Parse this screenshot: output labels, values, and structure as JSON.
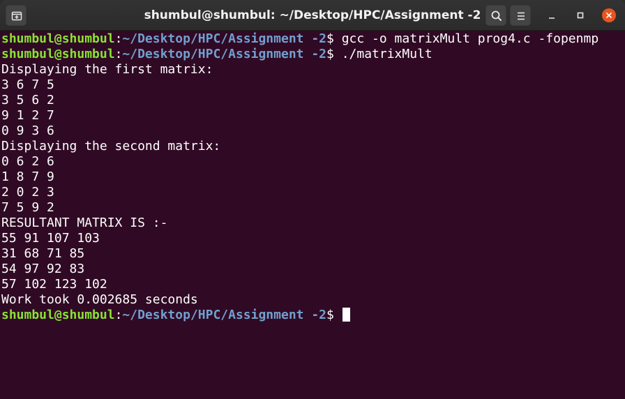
{
  "window": {
    "title": "shumbul@shumbul: ~/Desktop/HPC/Assignment -2",
    "icons": {
      "new_tab": "new-tab-icon",
      "search": "search-icon",
      "menu": "hamburger-menu-icon",
      "minimize": "minimize-icon",
      "maximize": "maximize-icon",
      "close": "close-icon"
    },
    "colors": {
      "terminal_bg": "#300a24",
      "prompt_user": "#8ae234",
      "prompt_path": "#729fcf",
      "text": "#ffffff",
      "close_button": "#e95420"
    }
  },
  "terminal": {
    "lines": [
      {
        "type": "prompt",
        "user": "shumbul@shumbul",
        "sep": ":",
        "path": "~/Desktop/HPC/Assignment -2",
        "sign": "$",
        "cmd": " gcc -o matrixMult prog4.c -fopenmp"
      },
      {
        "type": "prompt",
        "user": "shumbul@shumbul",
        "sep": ":",
        "path": "~/Desktop/HPC/Assignment -2",
        "sign": "$",
        "cmd": " ./matrixMult"
      },
      {
        "type": "output",
        "text": "Displaying the first matrix:"
      },
      {
        "type": "output",
        "text": "3 6 7 5"
      },
      {
        "type": "output",
        "text": "3 5 6 2"
      },
      {
        "type": "output",
        "text": "9 1 2 7"
      },
      {
        "type": "output",
        "text": "0 9 3 6"
      },
      {
        "type": "output",
        "text": "Displaying the second matrix:"
      },
      {
        "type": "output",
        "text": "0 6 2 6"
      },
      {
        "type": "output",
        "text": "1 8 7 9"
      },
      {
        "type": "output",
        "text": "2 0 2 3"
      },
      {
        "type": "output",
        "text": "7 5 9 2"
      },
      {
        "type": "output",
        "text": "RESULTANT MATRIX IS :-"
      },
      {
        "type": "output",
        "text": "55 91 107 103"
      },
      {
        "type": "output",
        "text": "31 68 71 85"
      },
      {
        "type": "output",
        "text": "54 97 92 83"
      },
      {
        "type": "output",
        "text": "57 102 123 102"
      },
      {
        "type": "output",
        "text": "Work took 0.002685 seconds"
      },
      {
        "type": "prompt",
        "user": "shumbul@shumbul",
        "sep": ":",
        "path": "~/Desktop/HPC/Assignment -2",
        "sign": "$",
        "cmd": " ",
        "cursor": true
      }
    ]
  }
}
